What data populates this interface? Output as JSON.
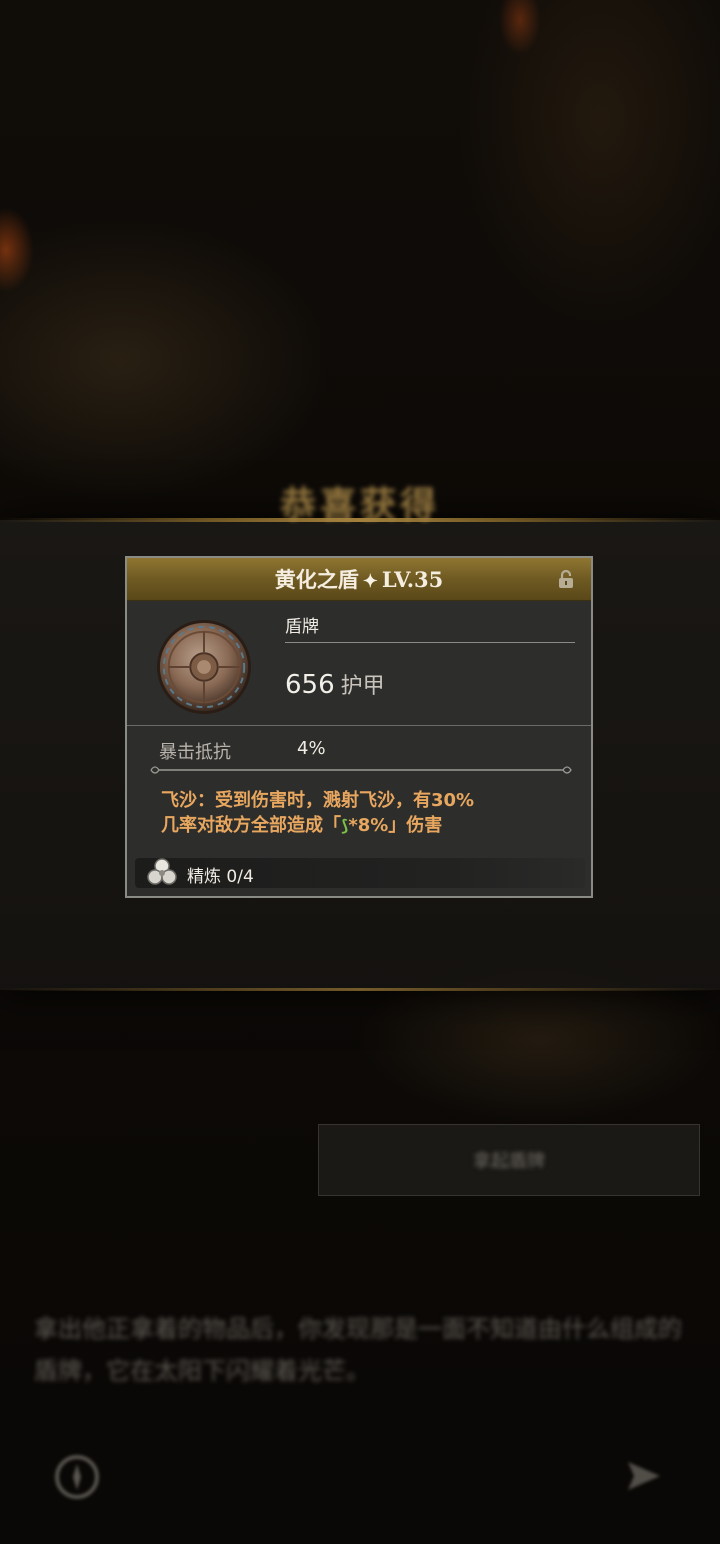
{
  "banner": {
    "title": "恭喜获得"
  },
  "item": {
    "name": "黄化之盾",
    "star_glyph": "✦",
    "level": "LV.35",
    "type": "盾牌",
    "armor_value": "656",
    "armor_unit": "护甲",
    "stat": {
      "name": "暴击抵抗",
      "value": "4%"
    },
    "effect_line1": "飞沙：受到伤害时，溅射飞沙，有30%",
    "effect_line2_pre": "几率对敌方全部造成「",
    "effect_glyph": "⟆",
    "effect_line2_post": "*8%」伤害",
    "refine": {
      "label": "精炼",
      "value": "0/4"
    }
  },
  "actions": {
    "collect_label": "拿起盾牌"
  },
  "description": "拿出他正拿着的物品后，你发现那是一面不知道由什么组成的盾牌，它在太阳下闪耀着光芒。",
  "colors": {
    "header_gold": "#8f7631",
    "effect_orange": "#e8a75f",
    "leaf_green": "#7bc246"
  },
  "icons": [
    "lock-icon",
    "shield-item-icon",
    "refine-flower-icon",
    "compass-icon",
    "send-icon"
  ]
}
